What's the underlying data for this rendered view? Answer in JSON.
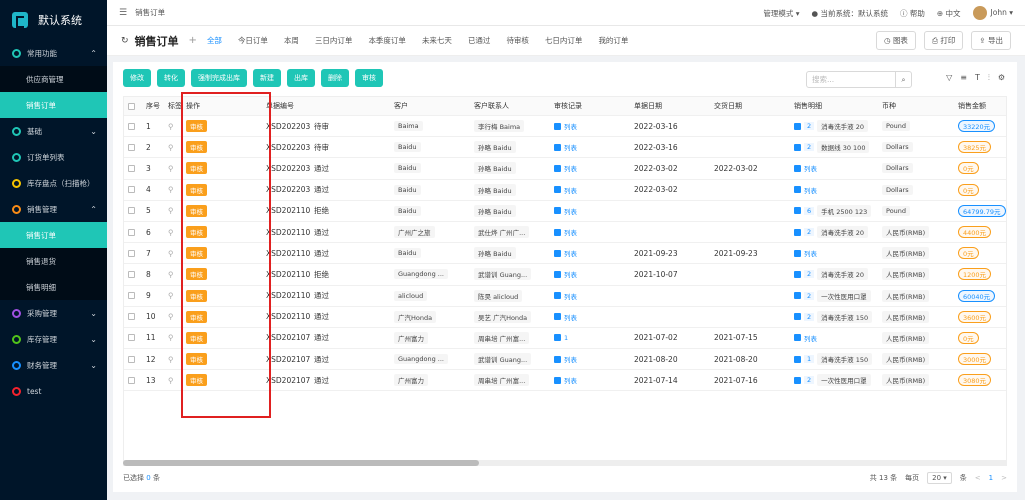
{
  "app": {
    "title": "默认系统"
  },
  "sidebar": {
    "items": [
      {
        "label": "常用功能",
        "arrow": "^",
        "color": "#1fc6b6"
      },
      {
        "label": "供应商管理",
        "sub": true
      },
      {
        "label": "销售订单",
        "sub": true,
        "active": true
      },
      {
        "label": "基础",
        "arrow": "v",
        "color": "#1fc6b6"
      },
      {
        "label": "订货单列表",
        "color": "#1fc6b6"
      },
      {
        "label": "库存盘点（扫描枪）",
        "color": "#f5c400"
      },
      {
        "label": "销售管理",
        "arrow": "^",
        "color": "#fa8c16"
      },
      {
        "label": "销售订单",
        "sub": true,
        "active": true
      },
      {
        "label": "销售退货",
        "sub": true
      },
      {
        "label": "销售明细",
        "sub": true
      },
      {
        "label": "采购管理",
        "arrow": "v",
        "color": "#a050e0"
      },
      {
        "label": "库存管理",
        "arrow": "v",
        "color": "#52c41a"
      },
      {
        "label": "财务管理",
        "arrow": "v",
        "color": "#1890ff"
      },
      {
        "label": "test",
        "color": "#f5222d"
      }
    ]
  },
  "topbar": {
    "breadcrumb": "销售订单",
    "mode": "管理模式 ▾",
    "system": "当前系统：默认系统",
    "help": "帮助",
    "lang": "中文",
    "user": "John"
  },
  "header": {
    "title": "销售订单",
    "add": "+",
    "tabs": [
      "全部",
      "今日订单",
      "本周",
      "三日内订单",
      "本季度订单",
      "未来七天",
      "已通过",
      "待审核",
      "七日内订单",
      "我的订单"
    ],
    "chart_btn": "图表",
    "print_btn": "打印",
    "export_btn": "导出"
  },
  "toolbar": {
    "buttons": [
      "修改",
      "转化",
      "强制完成出库",
      "新建",
      "出库",
      "删除",
      "审核"
    ],
    "search_placeholder": "搜索..."
  },
  "table": {
    "headers": [
      "序号",
      "标签",
      "操作",
      "单据编号",
      "",
      "客户",
      "客户联系人",
      "审核记录",
      "单据日期",
      "交货日期",
      "销售明细",
      "币种",
      "销售金额"
    ],
    "rows": [
      {
        "no": "1",
        "code": "XSD20220316140...",
        "status": "待审",
        "customer": "Baima",
        "contact": "李行梅 Baima",
        "audit": "列表",
        "date": "2022-03-16",
        "delivery": "",
        "dcount": "2",
        "detail": "消毒洗手液 20",
        "currency": "Pound",
        "amount": "33220元",
        "amtblue": true
      },
      {
        "no": "2",
        "code": "XSD20220316140...",
        "status": "待审",
        "customer": "Baidu",
        "contact": "孙略 Baidu",
        "audit": "列表",
        "date": "2022-03-16",
        "delivery": "",
        "dcount": "2",
        "detail": "数据线 30 100",
        "currency": "Dollars",
        "amount": "3825元",
        "amtblue": false
      },
      {
        "no": "3",
        "code": "XSD20220302122...",
        "status": "通过",
        "customer": "Baidu",
        "contact": "孙略 Baidu",
        "audit": "列表",
        "date": "2022-03-02",
        "delivery": "2022-03-02",
        "dcount": "",
        "detail": "列表",
        "currency": "Dollars",
        "amount": "0元",
        "amtblue": false
      },
      {
        "no": "4",
        "code": "XSD20220302122...",
        "status": "通过",
        "customer": "Baidu",
        "contact": "孙略 Baidu",
        "audit": "列表",
        "date": "2022-03-02",
        "delivery": "",
        "dcount": "",
        "detail": "列表",
        "currency": "Dollars",
        "amount": "0元",
        "amtblue": false
      },
      {
        "no": "5",
        "code": "XSD20211029102...",
        "status": "拒绝",
        "customer": "Baidu",
        "contact": "孙略 Baidu",
        "audit": "列表",
        "date": "",
        "delivery": "",
        "dcount": "6",
        "detail": "手机 2500 123",
        "currency": "Pound",
        "amount": "64799.79元",
        "amtblue": true
      },
      {
        "no": "6",
        "code": "XSD20211029102...",
        "status": "通过",
        "customer": "广州广之旅",
        "contact": "武仕烨 广州广...",
        "audit": "列表",
        "date": "",
        "delivery": "",
        "dcount": "2",
        "detail": "消毒洗手液 20",
        "currency": "人民币(RMB)",
        "amount": "4400元",
        "amtblue": false
      },
      {
        "no": "7",
        "code": "XSD20211028150...",
        "status": "通过",
        "customer": "Baidu",
        "contact": "孙略 Baidu",
        "audit": "列表",
        "date": "2021-09-23",
        "delivery": "2021-09-23",
        "dcount": "",
        "detail": "列表",
        "currency": "人民币(RMB)",
        "amount": "0元",
        "amtblue": false
      },
      {
        "no": "8",
        "code": "XSD20211022171...",
        "status": "拒绝",
        "customer": "Guangdong ...",
        "contact": "武谱训 Guang...",
        "audit": "列表",
        "date": "2021-10-07",
        "delivery": "",
        "dcount": "2",
        "detail": "消毒洗手液 20",
        "currency": "人民币(RMB)",
        "amount": "1200元",
        "amtblue": false
      },
      {
        "no": "9",
        "code": "XSD20211022170...",
        "status": "通过",
        "customer": "alicloud",
        "contact": "陈昊 alicloud",
        "audit": "列表",
        "date": "",
        "delivery": "",
        "dcount": "2",
        "detail": "一次性医用口罩",
        "currency": "人民币(RMB)",
        "amount": "60040元",
        "amtblue": true
      },
      {
        "no": "10",
        "code": "XSD20211022170...",
        "status": "通过",
        "customer": "广汽Honda",
        "contact": "吴艺 广汽Honda",
        "audit": "列表",
        "date": "",
        "delivery": "",
        "dcount": "2",
        "detail": "消毒洗手液 150",
        "currency": "人民币(RMB)",
        "amount": "3600元",
        "amtblue": false
      },
      {
        "no": "11",
        "code": "XSD20210719142...",
        "status": "通过",
        "customer": "广州富力",
        "contact": "周串培 广州富...",
        "audit": "1",
        "date": "2021-07-02",
        "delivery": "2021-07-15",
        "dcount": "",
        "detail": "列表",
        "currency": "人民币(RMB)",
        "amount": "0元",
        "amtblue": false
      },
      {
        "no": "12",
        "code": "XSD20210719140...",
        "status": "通过",
        "customer": "Guangdong ...",
        "contact": "武谱训 Guang...",
        "audit": "列表",
        "date": "2021-08-20",
        "delivery": "2021-08-20",
        "dcount": "1",
        "detail": "消毒洗手液 150",
        "currency": "人民币(RMB)",
        "amount": "3000元",
        "amtblue": false
      },
      {
        "no": "13",
        "code": "XSD20210715123...",
        "status": "通过",
        "customer": "广州富力",
        "contact": "周串培 广州富...",
        "audit": "列表",
        "date": "2021-07-14",
        "delivery": "2021-07-16",
        "dcount": "2",
        "detail": "一次性医用口罩",
        "currency": "人民币(RMB)",
        "amount": "3080元",
        "amtblue": false
      }
    ],
    "audit_label": "审核"
  },
  "footer": {
    "selected_prefix": "已选择",
    "selected_count": "0",
    "selected_suffix": "条",
    "total": "共 13 条",
    "per_page_label": "每页",
    "per_page": "20 ▾",
    "per_page_suffix": "条",
    "prev": "<",
    "page": "1",
    "next": ">"
  },
  "colors": {
    "accent": "#1fc6b6",
    "audit": "#fa9f1c",
    "link": "#1890ff",
    "highlight": "#e02020"
  }
}
